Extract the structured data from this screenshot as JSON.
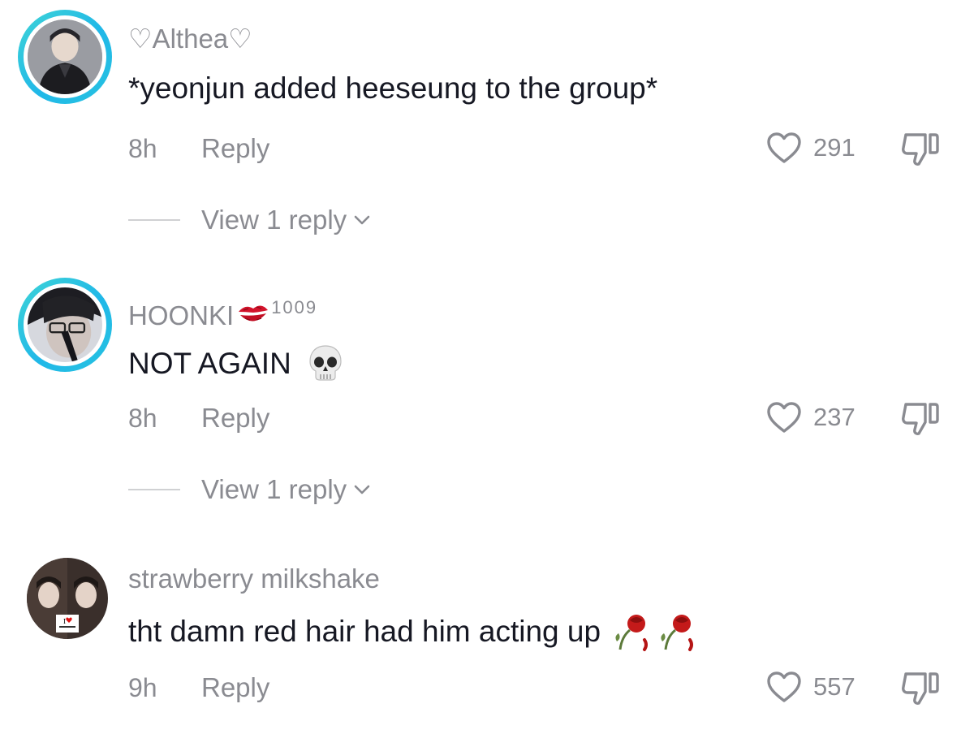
{
  "comments": [
    {
      "username": "♡Althea♡",
      "text": "*yeonjun added heeseung to the group*",
      "time": "8h",
      "reply_label": "Reply",
      "likes": "291",
      "view_replies": "View 1 reply"
    },
    {
      "username": "HOONKI",
      "username_suffix": "1009",
      "text": "NOT AGAIN",
      "time": "8h",
      "reply_label": "Reply",
      "likes": "237",
      "view_replies": "View 1 reply"
    },
    {
      "username": "strawberry milkshake",
      "text": "tht damn red hair had him acting up",
      "time": "9h",
      "reply_label": "Reply",
      "likes": "557"
    }
  ],
  "icons": {
    "like": "heart-outline-icon",
    "dislike": "thumbs-down-icon",
    "expand": "chevron-down-icon",
    "lips_emoji": "kiss-mark-icon",
    "skull_emoji": "skull-icon",
    "rose_emoji": "wilted-flower-icon"
  },
  "colors": {
    "primary_text": "#161823",
    "secondary_text": "#8a8b91",
    "story_ring": "#27c2e0"
  }
}
